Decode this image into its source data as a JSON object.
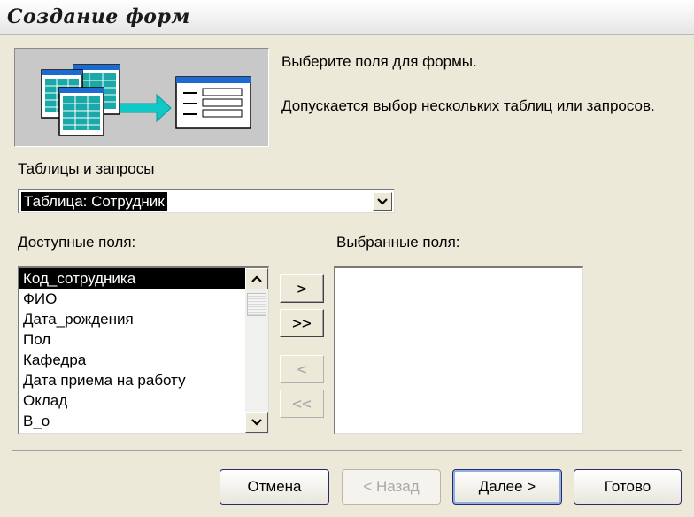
{
  "window": {
    "title": "Создание форм"
  },
  "intro": {
    "line1": "Выберите поля для формы.",
    "line2": "Допускается выбор нескольких таблиц или запросов."
  },
  "source": {
    "label": "Таблицы и запросы",
    "selected": "Таблица: Сотрудник"
  },
  "available": {
    "label": "Доступные поля:",
    "items": [
      "Код_сотрудника",
      "ФИО",
      "Дата_рождения",
      "Пол",
      "Кафедра",
      "Дата приема на работу",
      "Оклад",
      "В_о"
    ],
    "selected_index": 0
  },
  "chosen": {
    "label": "Выбранные поля:",
    "items": []
  },
  "move_buttons": {
    "add_one": ">",
    "add_all": ">>",
    "remove_one": "<",
    "remove_all": "<<"
  },
  "footer": {
    "cancel": "Отмена",
    "back": "< Назад",
    "next": "Далее >",
    "finish": "Готово"
  },
  "icons": {
    "combo_arrow": "chevron-down-icon",
    "scroll_up": "chevron-up-icon",
    "scroll_down": "chevron-down-icon",
    "illustration": "tables-to-form-icon"
  }
}
